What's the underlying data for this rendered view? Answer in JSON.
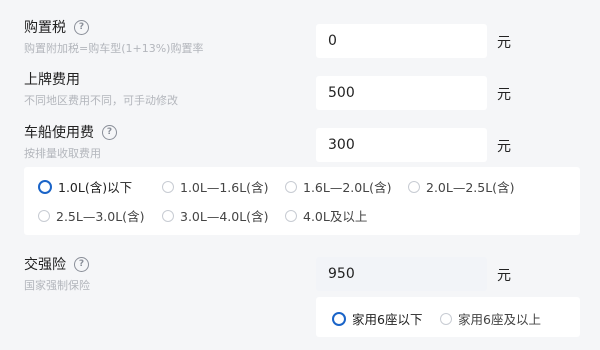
{
  "purchase_tax": {
    "label": "购置税",
    "help": "?",
    "desc": "购置附加税=购车型(1+13%)购置率",
    "value": "0",
    "unit": "元"
  },
  "plate_fee": {
    "label": "上牌费用",
    "desc": "不同地区费用不同，可手动修改",
    "value": "500",
    "unit": "元"
  },
  "vessel_tax": {
    "label": "车船使用费",
    "help": "?",
    "desc": "按排量收取费用",
    "value": "300",
    "unit": "元",
    "options": [
      {
        "label": "1.0L(含)以下",
        "selected": true
      },
      {
        "label": "1.0L—1.6L(含)",
        "selected": false
      },
      {
        "label": "1.6L—2.0L(含)",
        "selected": false
      },
      {
        "label": "2.0L—2.5L(含)",
        "selected": false
      },
      {
        "label": "2.5L—3.0L(含)",
        "selected": false
      },
      {
        "label": "3.0L—4.0L(含)",
        "selected": false
      },
      {
        "label": "4.0L及以上",
        "selected": false
      }
    ]
  },
  "compulsory_insurance": {
    "label": "交强险",
    "help": "?",
    "desc": "国家强制保险",
    "value": "950",
    "unit": "元",
    "options": [
      {
        "label": "家用6座以下",
        "selected": true
      },
      {
        "label": "家用6座及以上",
        "selected": false
      }
    ]
  },
  "colors": {
    "accent": "#1a64c8",
    "background": "#f5f6f8"
  }
}
